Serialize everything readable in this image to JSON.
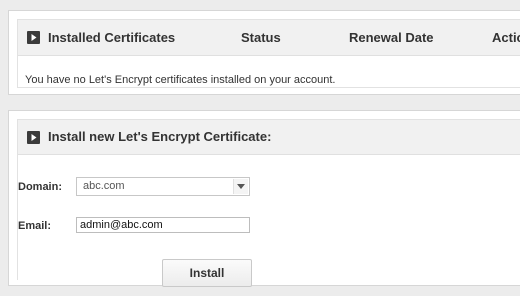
{
  "installed": {
    "columns": [
      "Installed Certificates",
      "Status",
      "Renewal Date",
      "Actio"
    ],
    "empty_message": "You have no Let's Encrypt certificates installed on your account."
  },
  "install": {
    "title": "Install new Let's Encrypt Certificate:",
    "domain_label": "Domain:",
    "domain_value": "abc.com",
    "email_label": "Email:",
    "email_value": "admin@abc.com",
    "install_button": "Install"
  }
}
